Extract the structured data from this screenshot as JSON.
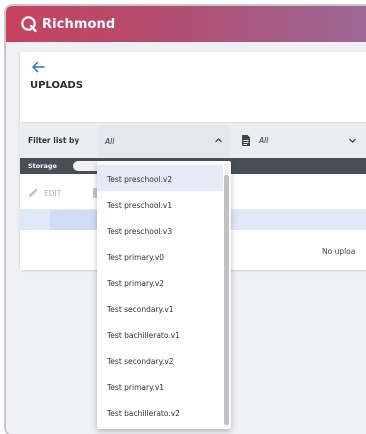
{
  "header": {
    "brand": "Richmond"
  },
  "page": {
    "title": "UPLOADS"
  },
  "filters": {
    "label": "Filter list by",
    "primary_select_value": "All",
    "secondary_select_value": "All"
  },
  "storage": {
    "label": "Storage"
  },
  "toolbar": {
    "edit_label": "EDIT"
  },
  "table": {
    "empty_text": "No uploa"
  },
  "dropdown": {
    "selected_index": 0,
    "options": [
      "Test preschool.v2",
      "Test preschool.v1",
      "Test preschool.v3",
      "Test primary.v0",
      "Test primary.v2",
      "Test secondary.v1",
      "Test bachillerato.v1",
      "Test secondary.v2",
      "Test primary.v1",
      "Test bachillerato.v2"
    ]
  },
  "colors": {
    "topbar_start": "#c7425f",
    "topbar_end": "#9c6a98",
    "accent_blue": "#2f6fd6",
    "selected_row": "#e4ebf7"
  },
  "icons": [
    "richmond-logo-icon",
    "back-arrow-icon",
    "chevron-up-icon",
    "document-icon",
    "chevron-down-icon",
    "pencil-icon"
  ]
}
